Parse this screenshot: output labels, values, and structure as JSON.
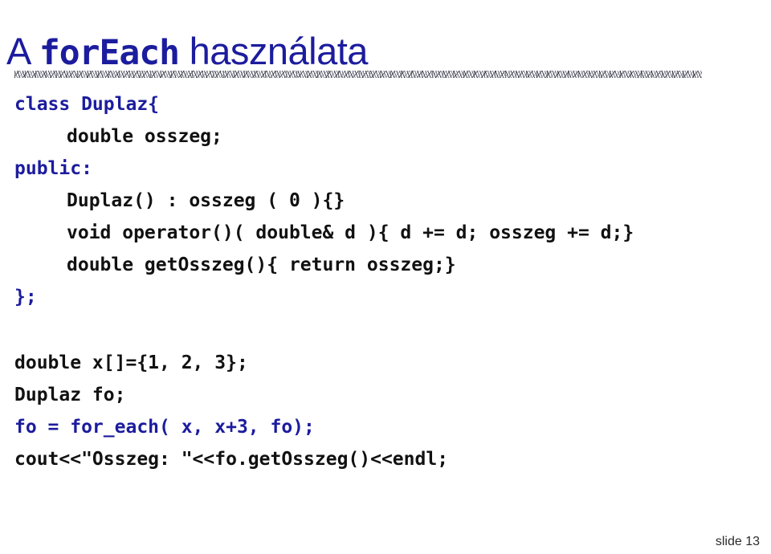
{
  "slide": {
    "title": {
      "prefix": "A ",
      "mono": "forEach",
      "suffix": " használata"
    },
    "divider": {
      "style": "speckled-texture-rule"
    },
    "footer": "slide 13",
    "colors": {
      "accent_blue": "#1c1c9e",
      "text_black": "#111111",
      "background": "#ffffff"
    }
  },
  "code_blocks": [
    {
      "id": "class-definition",
      "lines": [
        {
          "text": "class Duplaz{",
          "color": "blue",
          "indent": 0
        },
        {
          "text": "double osszeg;",
          "color": "black",
          "indent": 1
        },
        {
          "text": "public:",
          "color": "blue",
          "indent": 0
        },
        {
          "text": "Duplaz() : osszeg ( 0 ){}",
          "color": "black",
          "indent": 1
        },
        {
          "text": "void operator()( double& d ){ d += d; osszeg += d;}",
          "color": "black",
          "indent": 1
        },
        {
          "text": "double getOsszeg(){ return osszeg;}",
          "color": "black",
          "indent": 1
        },
        {
          "text": "};",
          "color": "blue",
          "indent": 0
        }
      ]
    },
    {
      "id": "main-usage",
      "lines": [
        {
          "text": "double x[]={1, 2, 3};",
          "color": "black",
          "indent": 0
        },
        {
          "text": "Duplaz fo;",
          "color": "black",
          "indent": 0
        },
        {
          "text": "fo = for_each( x, x+3, fo);",
          "color": "blue",
          "indent": 0
        },
        {
          "text": "cout<<\"Osszeg: \"<<fo.getOsszeg()<<endl;",
          "color": "black",
          "indent": 0
        }
      ]
    }
  ]
}
